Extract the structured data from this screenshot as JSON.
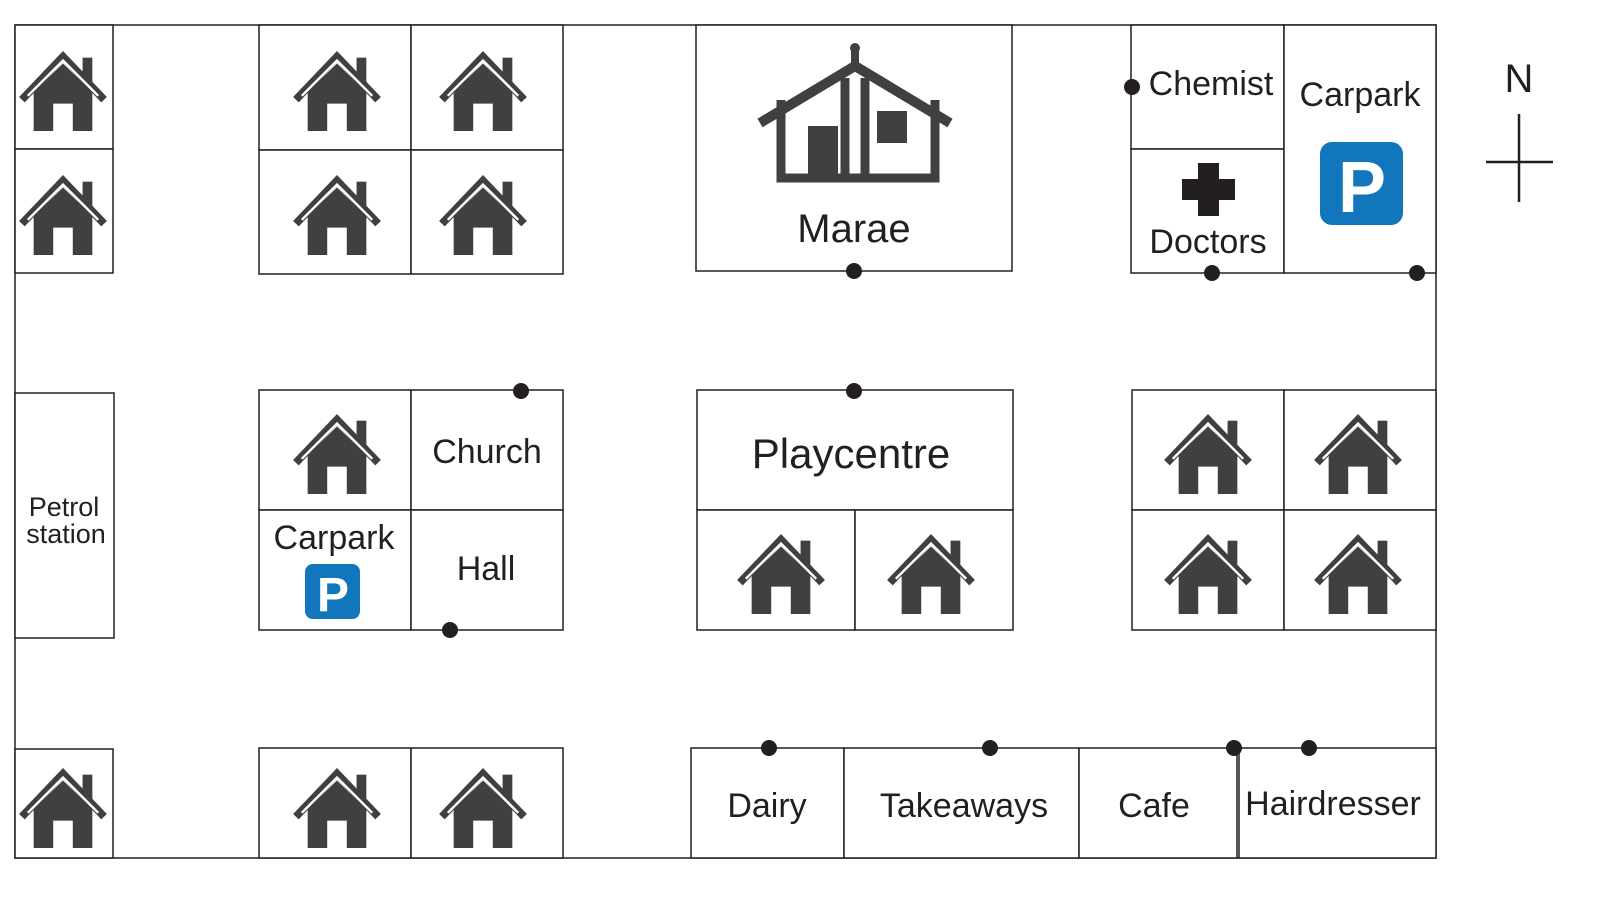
{
  "labels": {
    "marae": "Marae",
    "chemist": "Chemist",
    "doctors": "Doctors",
    "carpark_north": "Carpark",
    "petrol_line1": "Petrol",
    "petrol_line2": "station",
    "church": "Church",
    "carpark_central": "Carpark",
    "hall": "Hall",
    "playcentre": "Playcentre",
    "dairy": "Dairy",
    "takeaways": "Takeaways",
    "cafe": "Cafe",
    "hairdresser": "Hairdresser",
    "north": "N"
  },
  "parking_sign_letter": "P",
  "colors": {
    "icon": "#404040",
    "parking": "#1176bc",
    "line": "#231f20"
  },
  "icons": [
    "house-icon",
    "marae-icon",
    "medical-cross-icon",
    "parking-icon",
    "compass-icon",
    "entrance-dot"
  ]
}
